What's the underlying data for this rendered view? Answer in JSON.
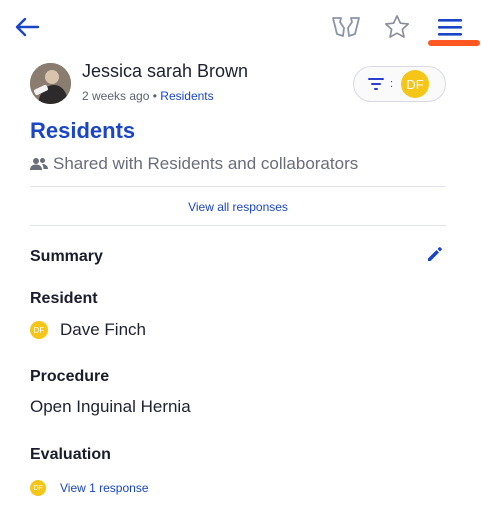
{
  "header": {
    "back_icon": "arrow-left-icon",
    "hands_icon": "open-hands-icon",
    "star_icon": "star-outline-icon",
    "menu_icon": "hamburger-menu-icon",
    "accent_color": "#1a45c7",
    "active_underline_color": "#ff5722"
  },
  "post": {
    "author": "Jessica sarah Brown",
    "time_ago": "2 weeks ago",
    "separator": "•",
    "group": "Residents",
    "filter": {
      "icon": "filter-icon",
      "colon": ":",
      "badge_initials": "DF",
      "badge_color": "#f5c518"
    },
    "title": "Residents",
    "shared_icon": "people-icon",
    "shared_text": "Shared with Residents and collaborators",
    "view_all_label": "View all responses"
  },
  "summary": {
    "heading": "Summary",
    "edit_icon": "pencil-icon",
    "resident_heading": "Resident",
    "resident_initials": "DF",
    "resident_name": "Dave Finch",
    "procedure_heading": "Procedure",
    "procedure_value": "Open Inguinal Hernia",
    "evaluation_heading": "Evaluation",
    "evaluation_initials": "DF",
    "evaluation_link": "View 1 response"
  }
}
